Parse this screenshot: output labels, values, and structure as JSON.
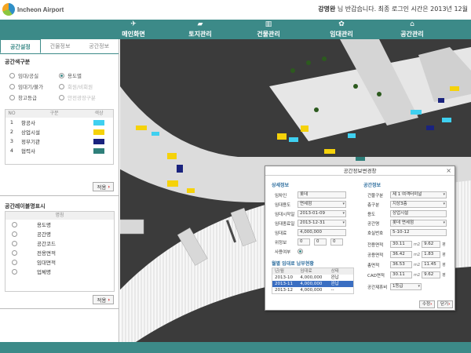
{
  "header": {
    "logo_text": "Incheon Airport",
    "user_name": "강명완",
    "welcome_text": " 님 반갑습니다. 최종 로그인 시간은 2013년 12월"
  },
  "nav": [
    {
      "label": "메인화면",
      "icon": "plane-icon"
    },
    {
      "label": "토지관리",
      "icon": "map-icon"
    },
    {
      "label": "건물관리",
      "icon": "building-icon"
    },
    {
      "label": "임대관리",
      "icon": "gear-icon"
    },
    {
      "label": "공간관리",
      "icon": "house-icon"
    }
  ],
  "left": {
    "tabs": [
      "공간설정",
      "건물정보",
      "공간정보"
    ],
    "color_section_title": "공간색구분",
    "radios": [
      {
        "label": "임대/공실",
        "checked": false,
        "dim": false
      },
      {
        "label": "용도별",
        "checked": true,
        "dim": false
      },
      {
        "label": "임대기/불가",
        "checked": false,
        "dim": false
      },
      {
        "label": "회원/비회원",
        "checked": false,
        "dim": true
      },
      {
        "label": "창고등급",
        "checked": false,
        "dim": false
      },
      {
        "label": "안전광장구분",
        "checked": false,
        "dim": true
      }
    ],
    "legend_headers": [
      "NO",
      "구분",
      "색상"
    ],
    "legend": [
      {
        "no": "1",
        "name": "항공사",
        "color": "#3fd0f0"
      },
      {
        "no": "2",
        "name": "상업시설",
        "color": "#f5d20a"
      },
      {
        "no": "3",
        "name": "정부기관",
        "color": "#1a237e"
      },
      {
        "no": "4",
        "name": "협력사",
        "color": "#2f7f7a"
      }
    ],
    "apply_label": "적용",
    "label_section_title": "공간레이블명표시",
    "label_header": "명칭",
    "label_items": [
      "용도명",
      "공간명",
      "공간코드",
      "전용면적",
      "임대면적",
      "업체명"
    ]
  },
  "dialog": {
    "title": "공간정보변경창",
    "detail_title": "상세정보",
    "space_title": "공간정보",
    "left_fields": [
      {
        "label": "임차인",
        "value": "롯데",
        "dd": false
      },
      {
        "label": "임대용도",
        "value": "면세점",
        "dd": true
      },
      {
        "label": "임대시작일",
        "value": "2013-01-09",
        "dd": true
      },
      {
        "label": "임대종료일",
        "value": "2013-12-31",
        "dd": true
      },
      {
        "label": "임대료",
        "value": "4,000,000",
        "dd": false
      },
      {
        "label": "위정보",
        "value": "0",
        "dd": false
      }
    ],
    "usage_label": "사용여부",
    "history_title": "월별 임대료 납부현황",
    "history_headers": [
      "년/월",
      "임대료",
      "상태"
    ],
    "history_rows": [
      {
        "ym": "2013-10",
        "fee": "4,000,000",
        "status": "완납",
        "sel": false
      },
      {
        "ym": "2013-11",
        "fee": "4,000,000",
        "status": "완납",
        "sel": true
      },
      {
        "ym": "2013-12",
        "fee": "4,000,000",
        "status": "--",
        "sel": false
      }
    ],
    "right_fields": [
      {
        "label": "건물구분",
        "value": "제 1 여객터미널",
        "dd": true
      },
      {
        "label": "층구분",
        "value": "지상3층",
        "dd": true
      },
      {
        "label": "용도",
        "value": "상업시설",
        "dd": false
      },
      {
        "label": "공간명",
        "value": "롯데 면세점",
        "dd": true
      },
      {
        "label": "호실번호",
        "value": "5-10-12",
        "dd": false
      }
    ],
    "area_rows": [
      {
        "label": "전용면적",
        "v1": "30.11",
        "v2": "9.62"
      },
      {
        "label": "공용면적",
        "v1": "36.42",
        "v2": "1.83"
      },
      {
        "label": "총면적",
        "v1": "36.53",
        "v2": "11.45"
      },
      {
        "label": "CAD면적",
        "v1": "30.11",
        "v2": "9.62"
      }
    ],
    "unit_m2": "m2",
    "unit_py": "평",
    "grade_label": "공간제휴비",
    "grade_value": "1등급",
    "edit_label": "수정",
    "close_label": "닫기"
  }
}
